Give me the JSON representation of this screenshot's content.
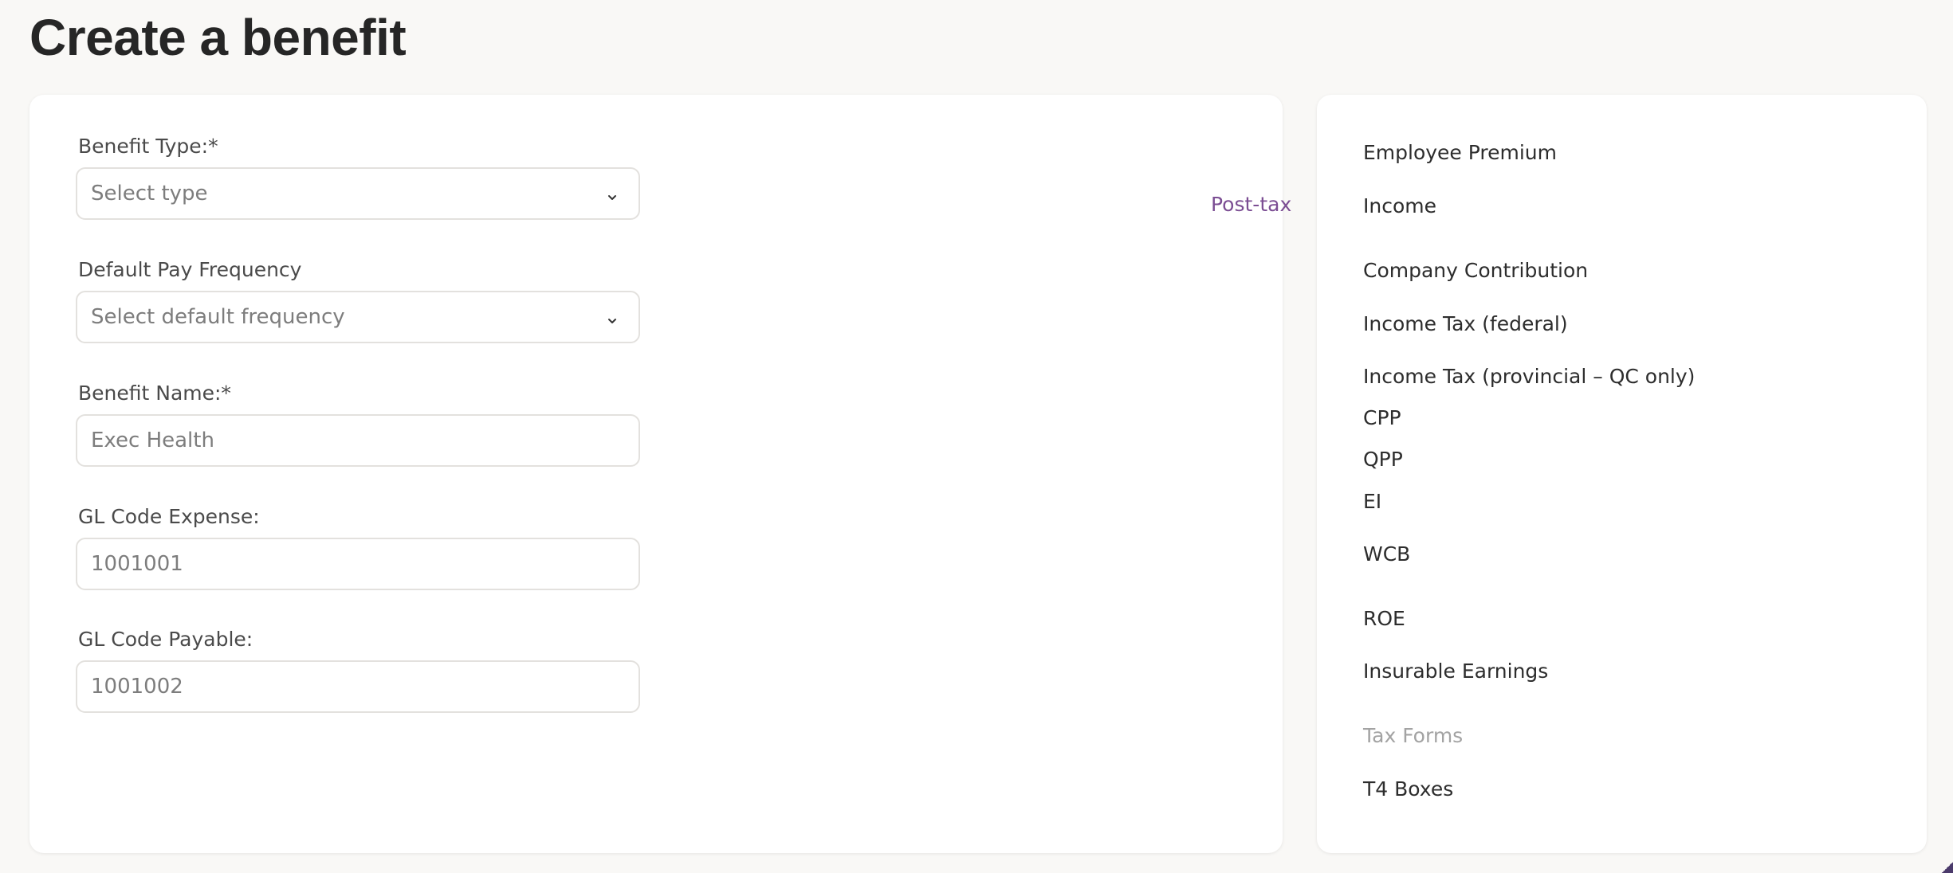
{
  "page": {
    "title": "Create a benefit"
  },
  "form": {
    "benefit_type": {
      "label": "Benefit Type:*",
      "placeholder": "Select type"
    },
    "pay_frequency": {
      "label": "Default Pay Frequency",
      "placeholder": "Select default frequency"
    },
    "benefit_name": {
      "label": "Benefit Name:*",
      "placeholder": "Exec Health"
    },
    "gl_expense": {
      "label": "GL Code Expense:",
      "placeholder": "1001001"
    },
    "gl_payable": {
      "label": "GL Code Payable:",
      "placeholder": "1001002"
    }
  },
  "side_panel": {
    "rows": [
      {
        "label": "Employee Premium",
        "value": ""
      },
      {
        "label": "Income",
        "value": "Post-tax"
      },
      {
        "label": "Company Contribution",
        "value": ""
      },
      {
        "label": "Income Tax (federal)",
        "value": ""
      },
      {
        "label": "Income Tax (provincial – QC only)",
        "value": ""
      },
      {
        "label": "CPP",
        "value": ""
      },
      {
        "label": "QPP",
        "value": ""
      },
      {
        "label": "EI",
        "value": ""
      },
      {
        "label": "WCB",
        "value": ""
      },
      {
        "label": "ROE",
        "value": ""
      },
      {
        "label": "Insurable Earnings",
        "value": ""
      },
      {
        "label": "Tax Forms",
        "value": ""
      },
      {
        "label": "T4 Boxes",
        "value": ""
      }
    ]
  },
  "colors": {
    "accent": "#7b4d93",
    "muted": "#a3a3a3",
    "background": "#f9f8f6"
  },
  "icons": {
    "dropdown": "chevron-down-icon"
  }
}
